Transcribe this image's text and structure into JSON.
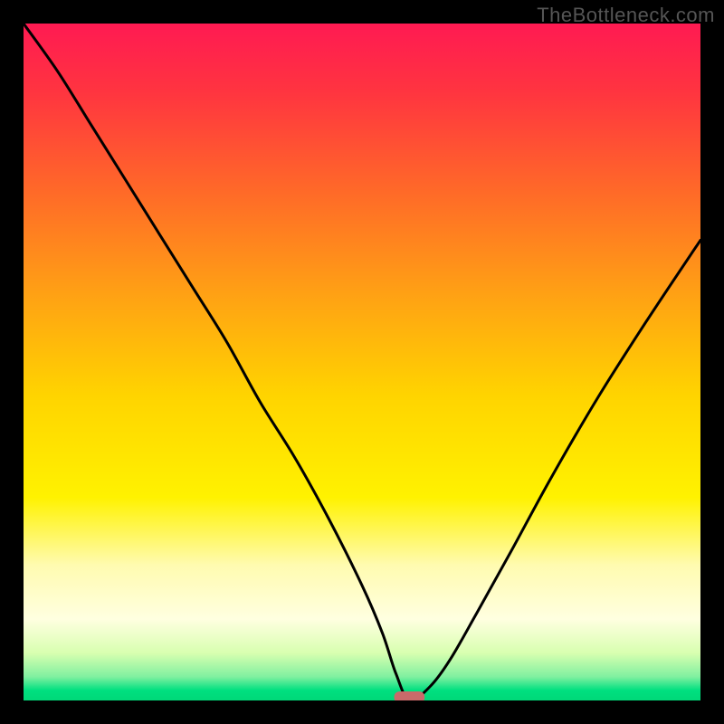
{
  "watermark": "TheBottleneck.com",
  "gradient": {
    "stops": [
      {
        "offset": 0.0,
        "color": "#ff1a52"
      },
      {
        "offset": 0.1,
        "color": "#ff3440"
      },
      {
        "offset": 0.25,
        "color": "#ff6a28"
      },
      {
        "offset": 0.4,
        "color": "#ffa114"
      },
      {
        "offset": 0.55,
        "color": "#ffd400"
      },
      {
        "offset": 0.7,
        "color": "#fff200"
      },
      {
        "offset": 0.8,
        "color": "#fffbb0"
      },
      {
        "offset": 0.88,
        "color": "#ffffe0"
      },
      {
        "offset": 0.93,
        "color": "#d8ffb0"
      },
      {
        "offset": 0.965,
        "color": "#80f0a0"
      },
      {
        "offset": 0.985,
        "color": "#00e080"
      },
      {
        "offset": 1.0,
        "color": "#00d878"
      }
    ]
  },
  "chart_data": {
    "type": "line",
    "title": "",
    "xlabel": "",
    "ylabel": "",
    "xlim": [
      0,
      100
    ],
    "ylim": [
      0,
      100
    ],
    "note": "V-shaped bottleneck curve: y is bottleneck percentage vs an unlabeled x-axis sweep. Minimum (optimal point) near x≈57. Values estimated from pixel positions; no axes or ticks are drawn.",
    "series": [
      {
        "name": "bottleneck-curve",
        "x": [
          0,
          5,
          10,
          15,
          20,
          25,
          30,
          35,
          40,
          45,
          50,
          53,
          55,
          57,
          60,
          63,
          67,
          72,
          78,
          85,
          92,
          100
        ],
        "y": [
          100,
          93,
          85,
          77,
          69,
          61,
          53,
          44,
          36,
          27,
          17,
          10,
          4,
          0,
          2,
          6,
          13,
          22,
          33,
          45,
          56,
          68
        ]
      }
    ],
    "marker": {
      "name": "optimal-point",
      "x": 57,
      "y": 0,
      "width_frac": 0.045,
      "color": "#c96a6a"
    }
  }
}
